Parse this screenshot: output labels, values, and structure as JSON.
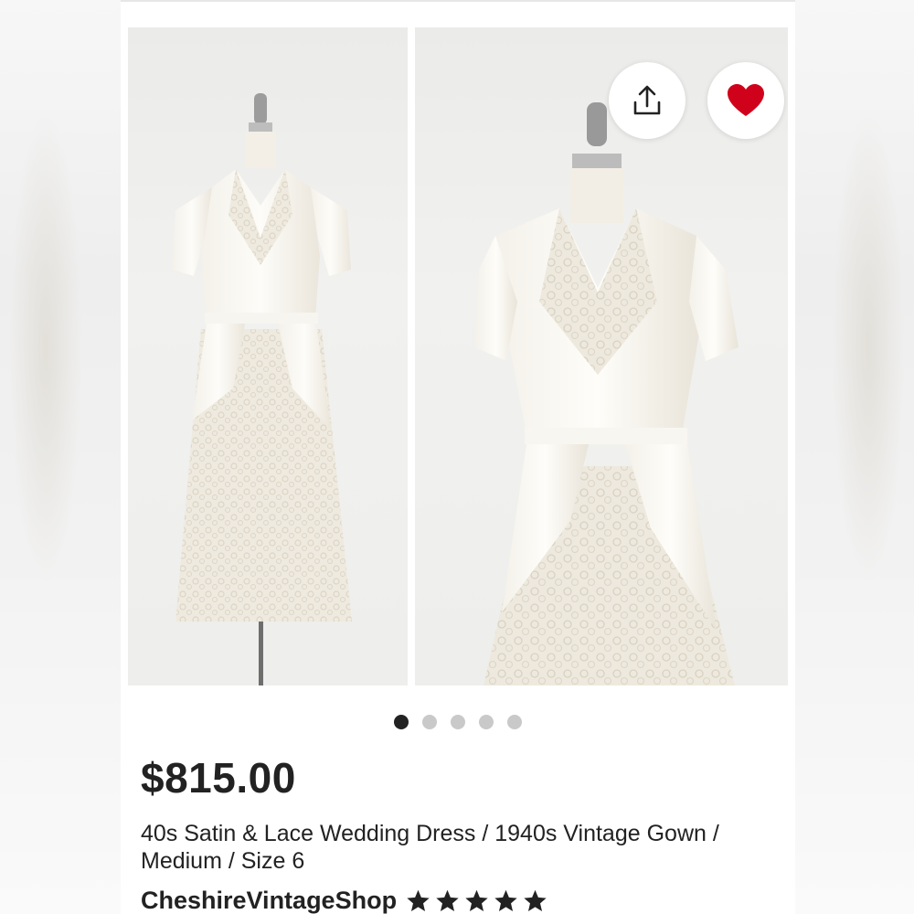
{
  "listing": {
    "price": "$815.00",
    "title": "40s Satin & Lace Wedding Dress / 1940s Vintage Gown / Medium / Size 6",
    "shop_name": "CheshireVintageShop",
    "rating_stars": 5
  },
  "gallery": {
    "photo_count": 5,
    "active_index": 0
  },
  "actions": {
    "share_icon": "share-icon",
    "favorite_icon": "heart-icon",
    "favorite_active": true
  },
  "colors": {
    "heart": "#d0021b",
    "text": "#222222",
    "dot_active": "#222222",
    "dot_inactive": "#c9c9c9"
  }
}
